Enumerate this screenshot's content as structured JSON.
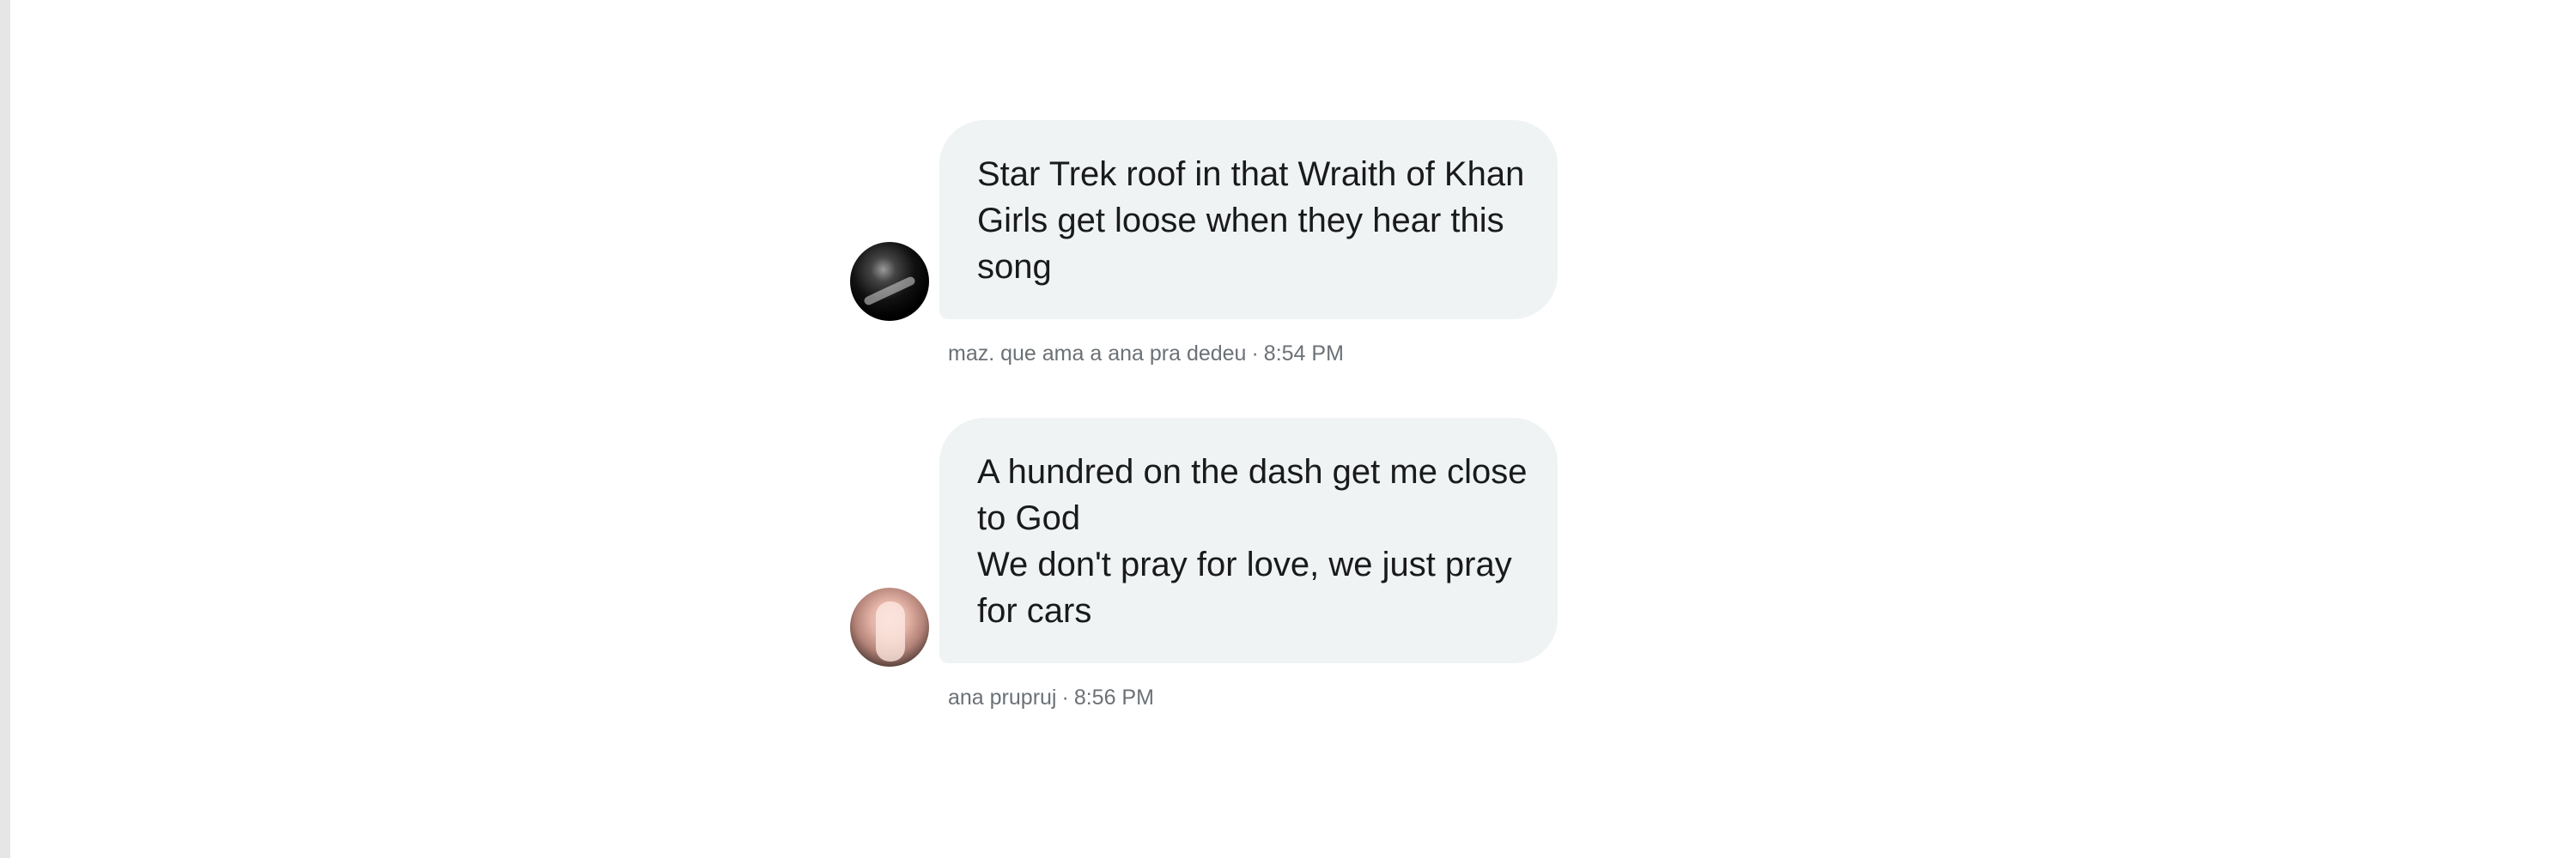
{
  "conversation": {
    "messages": [
      {
        "lines": [
          "Star Trek roof in that Wraith of Khan",
          "Girls get loose when they hear this",
          "song"
        ],
        "sender": "maz. que ama a ana pra dedeu",
        "separator": "·",
        "time": "8:54 PM",
        "avatar_icon": "dark-avatar"
      },
      {
        "lines": [
          "A hundred on the dash get me close",
          "to God",
          "We don't pray for love, we just pray",
          "for cars"
        ],
        "sender": "ana prupruj",
        "separator": "·",
        "time": "8:56 PM",
        "avatar_icon": "photo-avatar"
      }
    ]
  },
  "colors": {
    "background": "#ffffff",
    "bubble": "#eff3f4",
    "meta_text": "#6b7176",
    "edge": "#e6e6e6"
  }
}
